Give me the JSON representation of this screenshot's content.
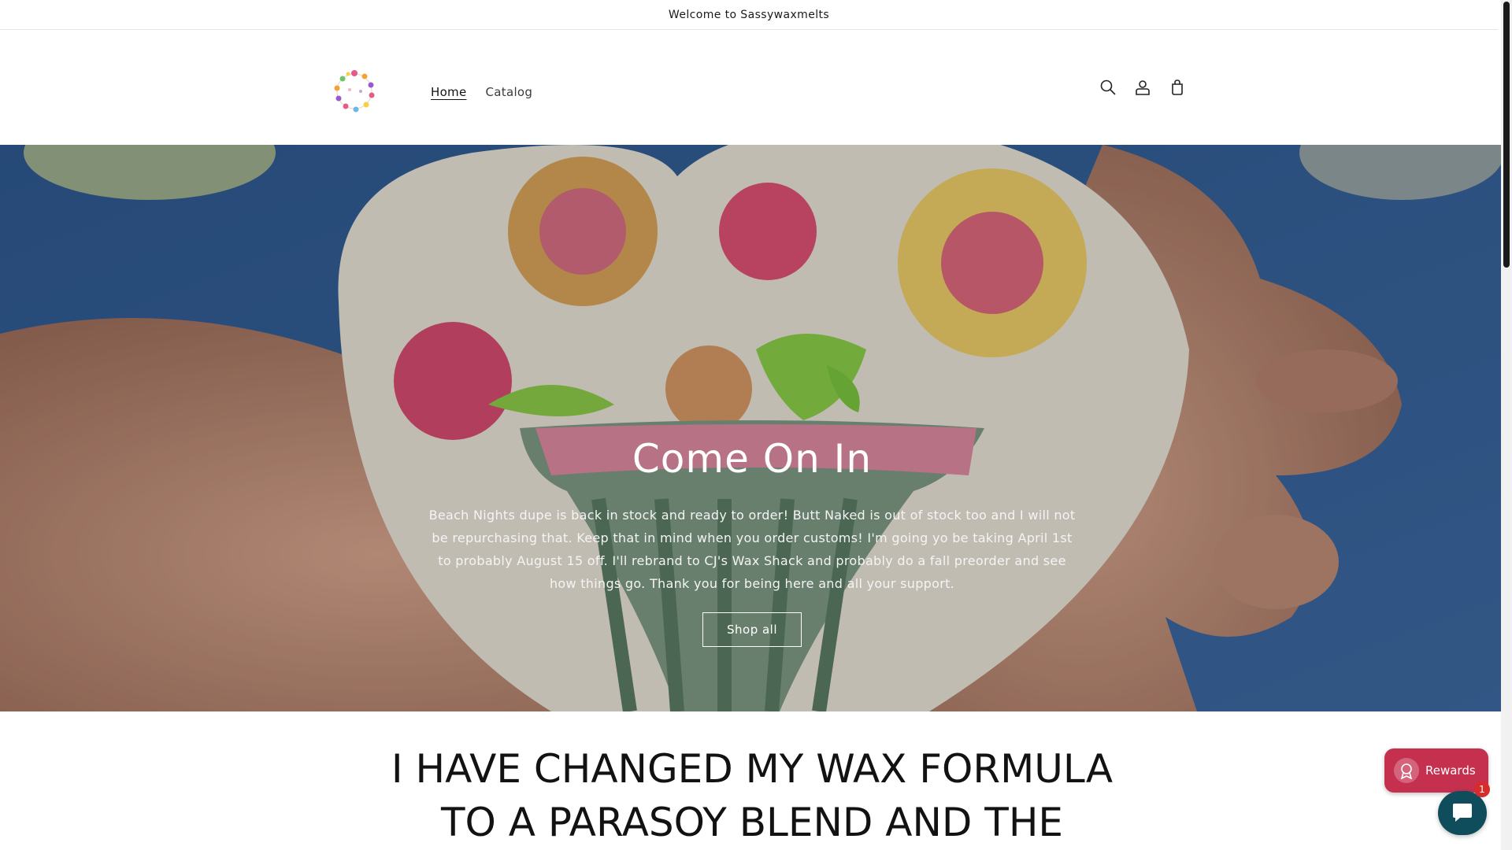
{
  "announcement": {
    "text": "Welcome to Sassywaxmelts"
  },
  "header": {
    "logo_alt": "Sassywaxmelts logo",
    "nav": [
      {
        "label": "Home",
        "active": true
      },
      {
        "label": "Catalog",
        "active": false
      }
    ],
    "icons": [
      "search-icon",
      "account-icon",
      "cart-icon"
    ]
  },
  "hero": {
    "title": "Come On In",
    "text": "Beach Nights dupe is back in stock and ready to order! Butt Naked is out of stock too and I will not be repurchasing that. Keep that in mind when you order customs! I'm going yo be taking April 1st to probably August 15 off. I'll rebrand to CJ's Wax Shack and probably do a fall preorder and see how things go. Thank you for being here and all your support.",
    "button_label": "Shop all"
  },
  "section": {
    "heading": "I HAVE CHANGED MY WAX FORMULA TO A PARASOY BLEND AND THE"
  },
  "widgets": {
    "rewards_label": "Rewards",
    "chat_badge_count": "1"
  },
  "colors": {
    "rewards_bg": "#c5304f",
    "chat_bg": "#0f4c5c",
    "hero_blue": "#35578a"
  }
}
